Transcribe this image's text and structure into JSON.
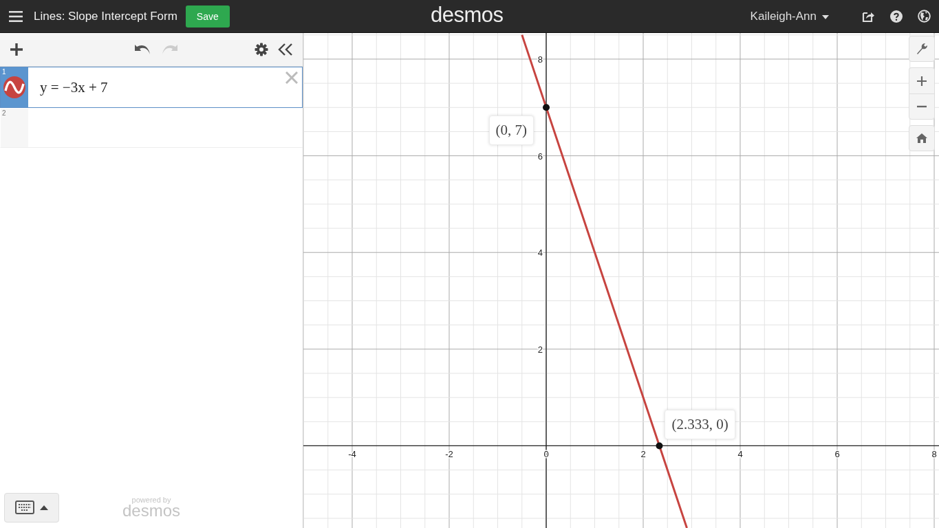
{
  "header": {
    "title": "Lines: Slope Intercept Form",
    "save_label": "Save",
    "logo": "desmos",
    "user": "Kaileigh-Ann"
  },
  "toolbar": {
    "undo_disabled": false,
    "redo_disabled": true
  },
  "expressions": [
    {
      "number": "1",
      "text": "y = −3x + 7",
      "color": "#c74440",
      "selected": true
    },
    {
      "number": "2",
      "selected": false
    }
  ],
  "footer": {
    "powered_by": "powered by",
    "brand": "desmos"
  },
  "graph": {
    "chart_data": {
      "type": "line",
      "x": [
        -0.5,
        2.9
      ],
      "grid": true,
      "series": [
        {
          "color": "#c74440",
          "values": [
            8.5,
            -1.7
          ]
        }
      ],
      "xlim": [
        -5.007,
        8.099
      ],
      "ylim": [
        -1.7,
        8.54
      ],
      "xticks": [
        -4,
        -2,
        0,
        2,
        4,
        6,
        8
      ],
      "yticks": [
        2,
        4,
        6,
        8
      ],
      "annotations": [
        {
          "x": 0,
          "y": 7,
          "text": "(0, 7)"
        },
        {
          "x": 2.333,
          "y": 0,
          "text": "(2.333, 0)"
        }
      ]
    }
  }
}
